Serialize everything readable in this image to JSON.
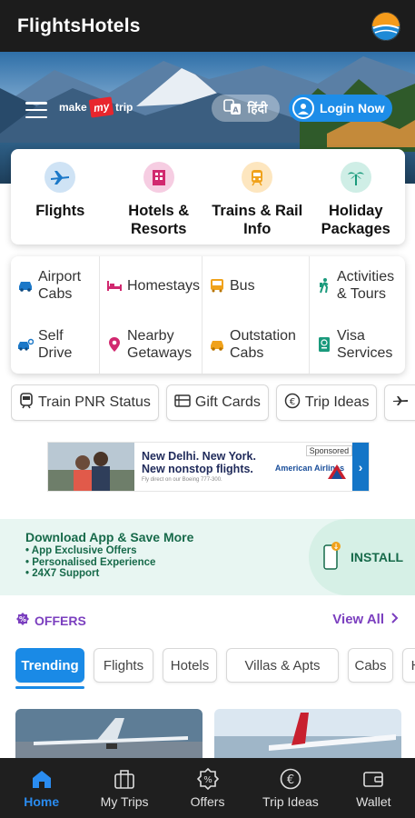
{
  "app_title": "FlightsHotels",
  "hero": {
    "brand_left": "make",
    "brand_mid": "my",
    "brand_right": "trip",
    "lang_label": "हिंदी",
    "login_label": "Login Now"
  },
  "categories": [
    {
      "label": "Flights",
      "icon": "airplane-icon",
      "color": "#cfe3f5"
    },
    {
      "label": "Hotels &\nResorts",
      "icon": "hotel-icon",
      "color": "#f6cde2"
    },
    {
      "label": "Trains & Rail\nInfo",
      "icon": "train-icon",
      "color": "#fde6bf"
    },
    {
      "label": "Holiday\nPackages",
      "icon": "palm-tree-icon",
      "color": "#cfeee6"
    }
  ],
  "subcategories": [
    {
      "label": "Airport\nCabs",
      "icon": "car-icon"
    },
    {
      "label": "Homestays",
      "icon": "bed-icon"
    },
    {
      "label": "Bus",
      "icon": "bus-icon"
    },
    {
      "label": "Activities\n& Tours",
      "icon": "hiker-icon"
    },
    {
      "label": "Self\nDrive",
      "icon": "self-drive-icon"
    },
    {
      "label": "Nearby\nGetaways",
      "icon": "location-pin-icon"
    },
    {
      "label": "Outstation\nCabs",
      "icon": "taxi-icon"
    },
    {
      "label": "Visa\nServices",
      "icon": "passport-icon"
    }
  ],
  "chips": [
    {
      "label": "Train PNR Status",
      "icon": "train-small-icon"
    },
    {
      "label": "Gift Cards",
      "icon": "gift-card-icon"
    },
    {
      "label": "Trip Ideas",
      "icon": "trip-ideas-icon"
    },
    {
      "label": "",
      "icon": "plane-small-icon"
    }
  ],
  "ad": {
    "title": "New Delhi. New York. New nonstop flights.",
    "subtitle": "Fly direct on our Boeing 777-300.",
    "sponsored": "Sponsored",
    "advertiser": "American Airlines",
    "arrow": "›"
  },
  "download": {
    "title": "Download App & Save More",
    "points": [
      "App Exclusive Offers",
      "Personalised Experience",
      "24X7 Support"
    ],
    "install_label": "INSTALL"
  },
  "offers": {
    "title": "OFFERS",
    "view_all": "View All",
    "tabs": [
      "Trending",
      "Flights",
      "Hotels",
      "Villas & Apts",
      "Cabs",
      "H"
    ],
    "active_tab": "Trending"
  },
  "bottom_nav": [
    {
      "label": "Home",
      "icon": "home-icon",
      "active": true
    },
    {
      "label": "My Trips",
      "icon": "suitcase-icon",
      "active": false
    },
    {
      "label": "Offers",
      "icon": "offer-badge-icon",
      "active": false
    },
    {
      "label": "Trip Ideas",
      "icon": "trip-ideas-icon",
      "active": false
    },
    {
      "label": "Wallet",
      "icon": "wallet-icon",
      "active": false
    }
  ],
  "colors": {
    "accent_blue": "#1a8ae6",
    "offers_purple": "#7b3fbf",
    "install_green": "#176a4a",
    "nav_bg": "#1f1f1f"
  }
}
